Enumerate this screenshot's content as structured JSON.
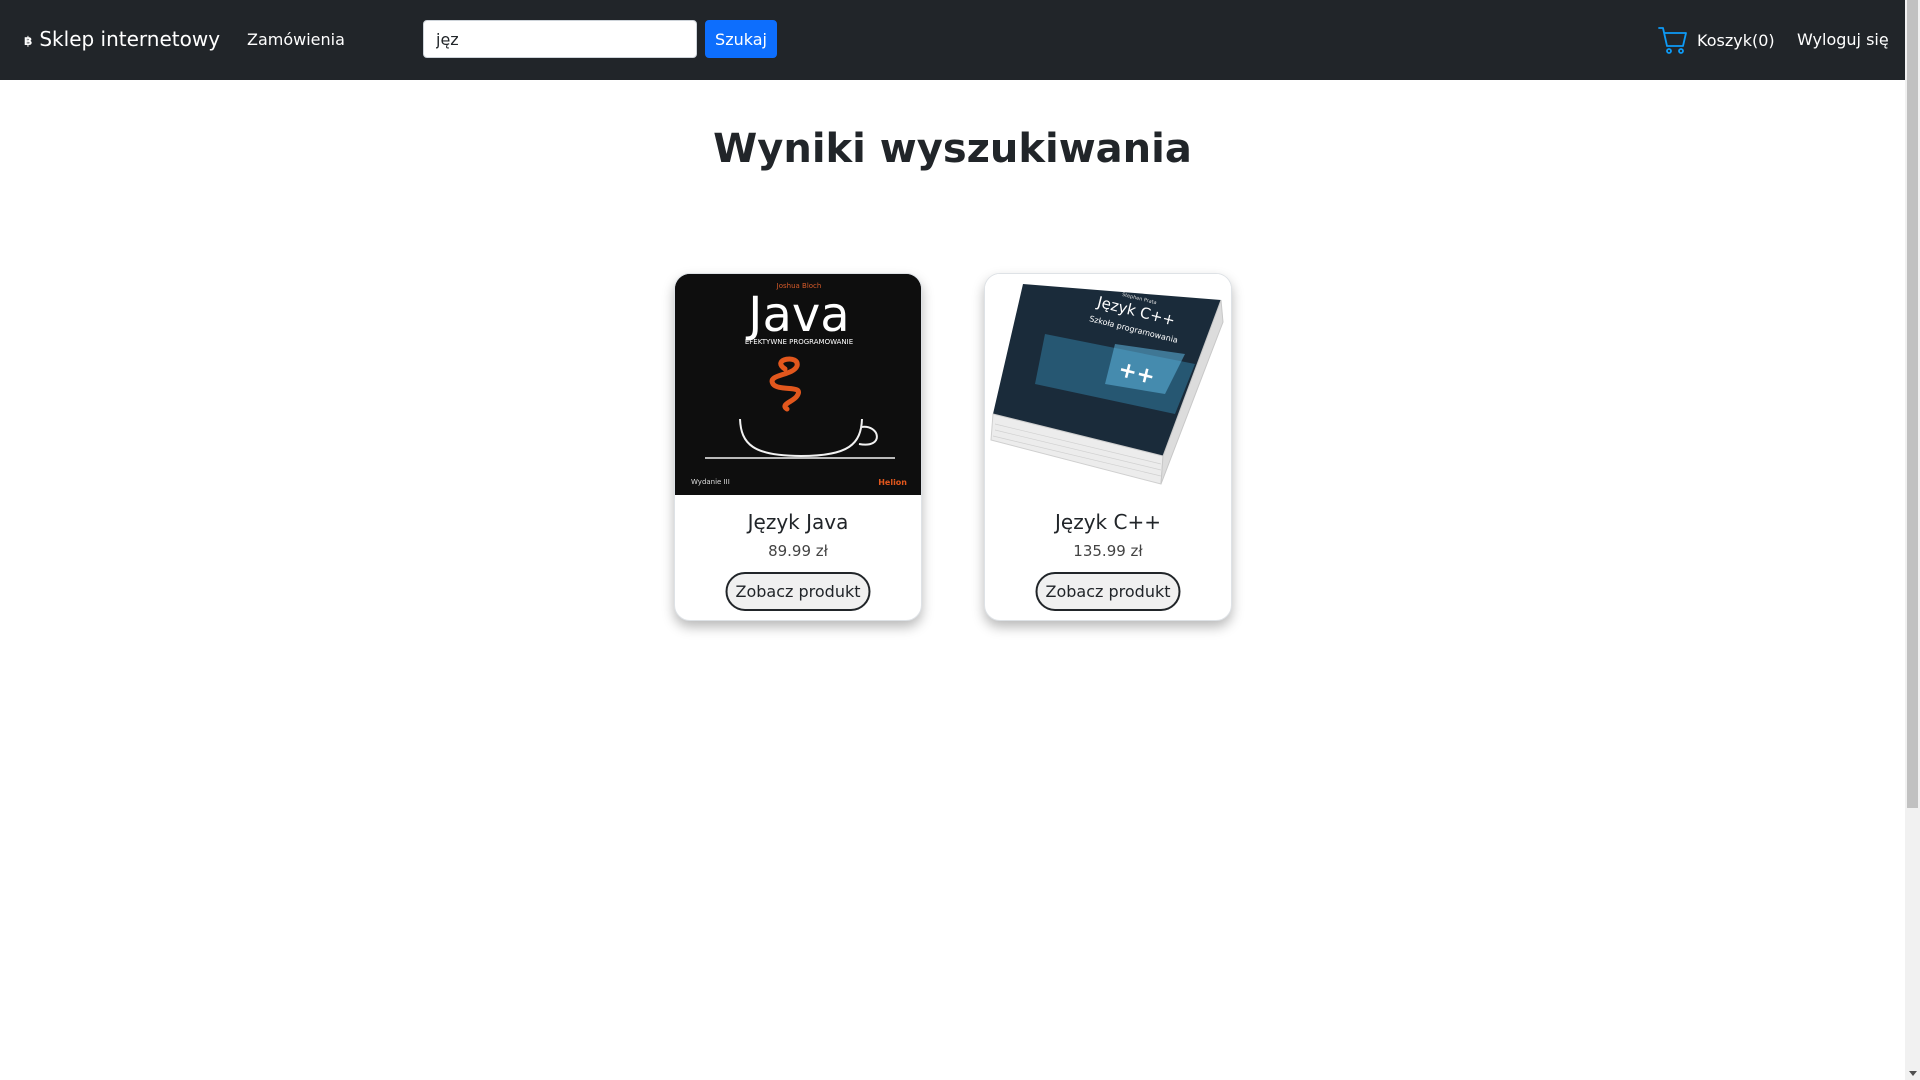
{
  "navbar": {
    "brand": "Sklep internetowy",
    "brand_icon": "bitcoin-icon",
    "orders_link": "Zamówienia",
    "search": {
      "value": "jęz",
      "placeholder": ""
    },
    "search_button": "Szukaj",
    "cart_label": "Koszyk(0)",
    "cart_icon": "cart-icon",
    "logout_link": "Wyloguj się",
    "bg_color": "#212529",
    "accent_color": "#0d6efd"
  },
  "main": {
    "title": "Wyniki wyszukiwania",
    "products": [
      {
        "name": "Język Java",
        "price": "89.99 zł",
        "button": "Zobacz produkt",
        "cover": {
          "author": "Joshua Bloch",
          "title": "Java",
          "subtitle": "EFEKTYWNE PROGRAMOWANIE",
          "edition": "Wydanie III",
          "publisher": "Helion"
        }
      },
      {
        "name": "Język C++",
        "price": "135.99 zł",
        "button": "Zobacz produkt",
        "cover": {
          "author": "Stephen Prata",
          "title": "Język C++",
          "subtitle": "Szkoła programowania"
        }
      }
    ]
  }
}
